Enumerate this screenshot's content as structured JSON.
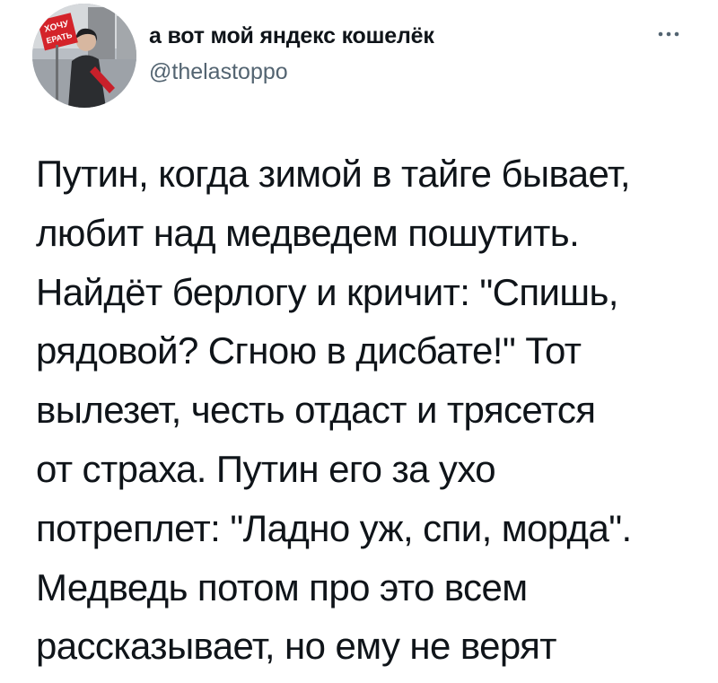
{
  "tweet": {
    "author": {
      "display_name": "а вот мой яндекс кошелёк",
      "handle": "@thelastoppo",
      "avatar_sign_text": [
        "ХОЧУ",
        "ЕРАТЬ"
      ]
    },
    "more_icon": "ellipsis-icon",
    "text_lines": [
      "Путин, когда зимой в тайге бывает,",
      "любит над медведем пошутить.",
      "Найдёт берлогу и кричит: \"Спишь,",
      "рядовой? Сгною в дисбате!\" Тот",
      "вылезет, честь отдаст и трясется",
      "от страха. Путин его за ухо",
      "потреплет: \"Ладно уж, спи, морда\".",
      "Медведь потом про это всем",
      "рассказывает, но ему не верят"
    ],
    "colors": {
      "text": "#0f1419",
      "secondary_text": "#536471",
      "background": "#ffffff"
    }
  }
}
